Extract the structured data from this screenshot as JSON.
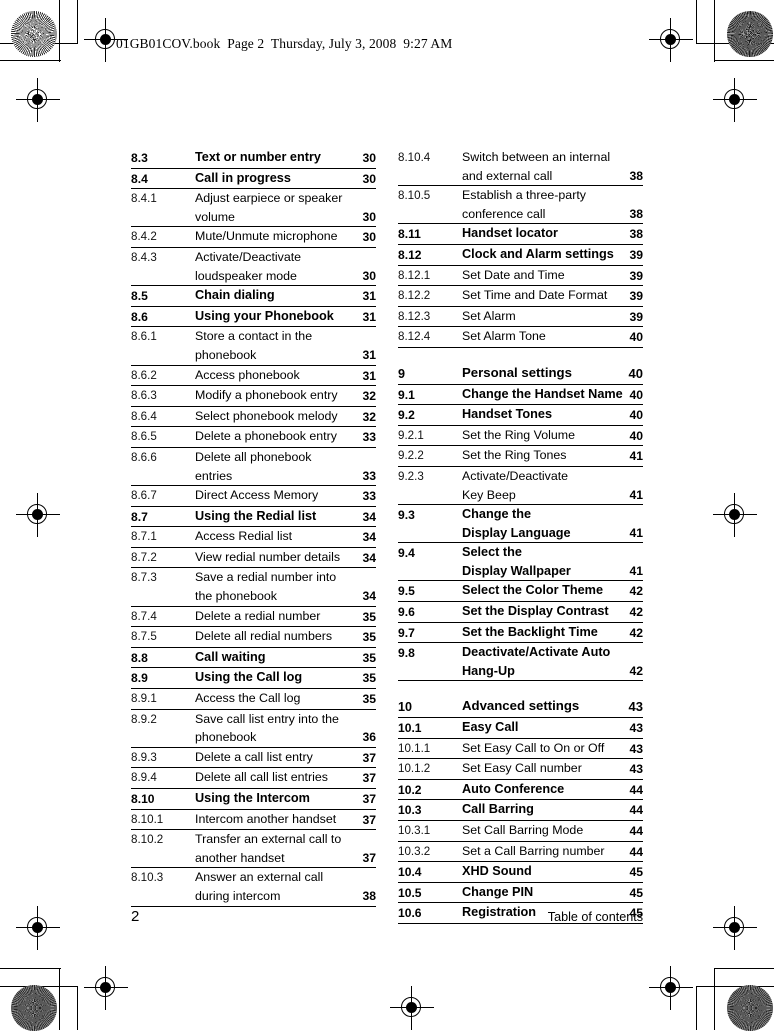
{
  "header": {
    "slug": "01GB01COV.book  Page 2  Thursday, July 3, 2008  9:27 AM"
  },
  "footer": {
    "page_number": "2",
    "section_label": "Table of contents"
  },
  "toc": {
    "left_column": [
      {
        "number": "8.3",
        "title": "Text or number entry",
        "cont": "",
        "page": "30",
        "level": "2"
      },
      {
        "number": "8.4",
        "title": "Call in progress",
        "cont": "",
        "page": "30",
        "level": "2"
      },
      {
        "number": "8.4.1",
        "title": "Adjust earpiece or speaker",
        "cont": "volume",
        "page": "30",
        "level": "3"
      },
      {
        "number": "8.4.2",
        "title": "Mute/Unmute microphone",
        "cont": "",
        "page": "30",
        "level": "3"
      },
      {
        "number": "8.4.3",
        "title": "Activate/Deactivate",
        "cont": "loudspeaker mode",
        "page": "30",
        "level": "3"
      },
      {
        "number": "8.5",
        "title": "Chain dialing",
        "cont": "",
        "page": "31",
        "level": "2"
      },
      {
        "number": "8.6",
        "title": "Using your Phonebook",
        "cont": "",
        "page": "31",
        "level": "2"
      },
      {
        "number": "8.6.1",
        "title": "Store a contact in the",
        "cont": "phonebook",
        "page": "31",
        "level": "3"
      },
      {
        "number": "8.6.2",
        "title": "Access phonebook",
        "cont": "",
        "page": "31",
        "level": "3"
      },
      {
        "number": "8.6.3",
        "title": "Modify a phonebook entry",
        "cont": "",
        "page": "32",
        "level": "3"
      },
      {
        "number": "8.6.4",
        "title": "Select phonebook melody",
        "cont": "",
        "page": "32",
        "level": "3"
      },
      {
        "number": "8.6.5",
        "title": "Delete a phonebook entry",
        "cont": "",
        "page": "33",
        "level": "3"
      },
      {
        "number": "8.6.6",
        "title": "Delete all phonebook",
        "cont": "entries",
        "page": "33",
        "level": "3"
      },
      {
        "number": "8.6.7",
        "title": "Direct Access Memory",
        "cont": "",
        "page": "33",
        "level": "3"
      },
      {
        "number": "8.7",
        "title": "Using the Redial list",
        "cont": "",
        "page": "34",
        "level": "2"
      },
      {
        "number": "8.7.1",
        "title": "Access Redial list",
        "cont": "",
        "page": "34",
        "level": "3"
      },
      {
        "number": "8.7.2",
        "title": "View redial number details",
        "cont": "",
        "page": "34",
        "level": "3"
      },
      {
        "number": "8.7.3",
        "title": "Save a redial number into",
        "cont": "the phonebook",
        "page": "34",
        "level": "3"
      },
      {
        "number": "8.7.4",
        "title": "Delete a redial number",
        "cont": "",
        "page": "35",
        "level": "3"
      },
      {
        "number": "8.7.5",
        "title": "Delete all redial numbers",
        "cont": "",
        "page": "35",
        "level": "3"
      },
      {
        "number": "8.8",
        "title": "Call waiting",
        "cont": "",
        "page": "35",
        "level": "2"
      },
      {
        "number": "8.9",
        "title": "Using the Call log",
        "cont": "",
        "page": "35",
        "level": "2"
      },
      {
        "number": "8.9.1",
        "title": "Access the Call log",
        "cont": "",
        "page": "35",
        "level": "3"
      },
      {
        "number": "8.9.2",
        "title": "Save call list entry into the",
        "cont": "phonebook",
        "page": "36",
        "level": "3"
      },
      {
        "number": "8.9.3",
        "title": "Delete a call list entry",
        "cont": "",
        "page": "37",
        "level": "3"
      },
      {
        "number": "8.9.4",
        "title": "Delete all call list entries",
        "cont": "",
        "page": "37",
        "level": "3"
      },
      {
        "number": "8.10",
        "title": "Using the Intercom",
        "cont": "",
        "page": "37",
        "level": "2"
      },
      {
        "number": "8.10.1",
        "title": "Intercom another handset",
        "cont": "",
        "page": "37",
        "level": "3"
      },
      {
        "number": "8.10.2",
        "title": "Transfer an external call to",
        "cont": "another handset",
        "page": "37",
        "level": "3"
      },
      {
        "number": "8.10.3",
        "title": "Answer an external call",
        "cont": "during intercom",
        "page": "38",
        "level": "3"
      }
    ],
    "right_column": [
      {
        "number": "8.10.4",
        "title": "Switch between an internal",
        "cont": "and external call",
        "page": "38",
        "level": "3"
      },
      {
        "number": "8.10.5",
        "title": "Establish a three-party",
        "cont": "conference call",
        "page": "38",
        "level": "3"
      },
      {
        "number": "8.11",
        "title": "Handset locator",
        "cont": "",
        "page": "38",
        "level": "2"
      },
      {
        "number": "8.12",
        "title": "Clock and Alarm settings",
        "cont": "",
        "page": "39",
        "level": "2"
      },
      {
        "number": "8.12.1",
        "title": "Set Date and Time",
        "cont": "",
        "page": "39",
        "level": "3"
      },
      {
        "number": "8.12.2",
        "title": "Set Time and Date Format",
        "cont": "",
        "page": "39",
        "level": "3"
      },
      {
        "number": "8.12.3",
        "title": "Set Alarm",
        "cont": "",
        "page": "39",
        "level": "3"
      },
      {
        "number": "8.12.4",
        "title": "Set Alarm Tone",
        "cont": "",
        "page": "40",
        "level": "3"
      },
      {
        "number": "",
        "title": "",
        "cont": "",
        "page": "",
        "level": "spacer"
      },
      {
        "number": "9",
        "title": "Personal settings",
        "cont": "",
        "page": "40",
        "level": "major"
      },
      {
        "number": "9.1",
        "title": "Change the Handset Name",
        "cont": "",
        "page": "40",
        "level": "2"
      },
      {
        "number": "9.2",
        "title": "Handset Tones",
        "cont": "",
        "page": "40",
        "level": "2"
      },
      {
        "number": "9.2.1",
        "title": "Set the Ring Volume",
        "cont": "",
        "page": "40",
        "level": "3"
      },
      {
        "number": "9.2.2",
        "title": "Set the Ring Tones",
        "cont": "",
        "page": "41",
        "level": "3"
      },
      {
        "number": "9.2.3",
        "title": "Activate/Deactivate",
        "cont": "Key Beep",
        "page": "41",
        "level": "3"
      },
      {
        "number": "9.3",
        "title": "Change the",
        "cont": "Display Language",
        "page": "41",
        "level": "2"
      },
      {
        "number": "9.4",
        "title": "Select the",
        "cont": "Display Wallpaper",
        "page": "41",
        "level": "2"
      },
      {
        "number": "9.5",
        "title": "Select the Color Theme",
        "cont": "",
        "page": "42",
        "level": "2"
      },
      {
        "number": "9.6",
        "title": "Set the Display Contrast",
        "cont": "",
        "page": "42",
        "level": "2"
      },
      {
        "number": "9.7",
        "title": "Set the Backlight Time",
        "cont": "",
        "page": "42",
        "level": "2"
      },
      {
        "number": "9.8",
        "title": "Deactivate/Activate Auto",
        "cont": "Hang-Up",
        "page": "42",
        "level": "2"
      },
      {
        "number": "",
        "title": "",
        "cont": "",
        "page": "",
        "level": "spacer"
      },
      {
        "number": "10",
        "title": "Advanced settings",
        "cont": "",
        "page": "43",
        "level": "major"
      },
      {
        "number": "10.1",
        "title": "Easy Call",
        "cont": "",
        "page": "43",
        "level": "2"
      },
      {
        "number": "10.1.1",
        "title": "Set Easy Call to On or Off",
        "cont": "",
        "page": "43",
        "level": "3"
      },
      {
        "number": "10.1.2",
        "title": "Set Easy Call number",
        "cont": "",
        "page": "43",
        "level": "3"
      },
      {
        "number": "10.2",
        "title": "Auto Conference",
        "cont": "",
        "page": "44",
        "level": "2"
      },
      {
        "number": "10.3",
        "title": "Call Barring",
        "cont": "",
        "page": "44",
        "level": "2"
      },
      {
        "number": "10.3.1",
        "title": "Set Call Barring Mode",
        "cont": "",
        "page": "44",
        "level": "3"
      },
      {
        "number": "10.3.2",
        "title": "Set a Call Barring number",
        "cont": "",
        "page": "44",
        "level": "3"
      },
      {
        "number": "10.4",
        "title": "XHD Sound",
        "cont": "",
        "page": "45",
        "level": "2"
      },
      {
        "number": "10.5",
        "title": "Change PIN",
        "cont": "",
        "page": "45",
        "level": "2"
      },
      {
        "number": "10.6",
        "title": "Registration",
        "cont": "",
        "page": "45",
        "level": "2"
      }
    ]
  },
  "press_marks": {
    "registration_icon": "registration-target",
    "density_icon": "starburst-density-patch"
  }
}
